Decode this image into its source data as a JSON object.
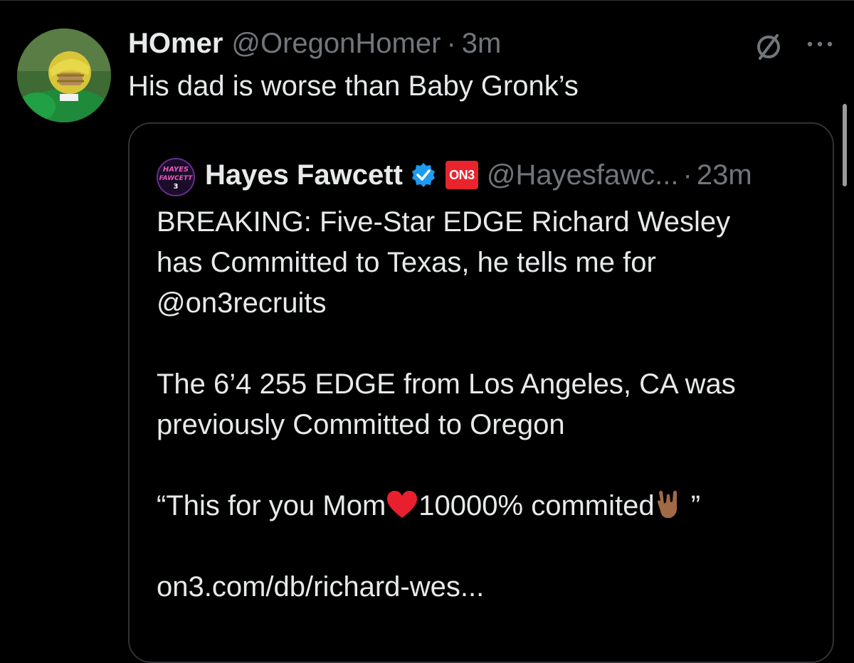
{
  "tweet": {
    "display_name": "HOmer",
    "handle": "@OregonHomer",
    "separator": "·",
    "time": "3m",
    "text": "His dad is worse than Baby Gronk’s",
    "avatar_icon": "football-player-avatar",
    "menu_icon": "more-icon",
    "grok_icon": "slash-icon"
  },
  "quote": {
    "display_name": "Hayes Fawcett",
    "verified_icon": "verified-badge-icon",
    "affiliate_label": "ON3",
    "handle": "@Hayesfawc...",
    "separator": "·",
    "time": "23m",
    "avatar_text": "HAYES FAWCETT 3",
    "paragraphs": [
      [
        "BREAKING: Five-Star EDGE Richard Wesley",
        "has Committed to Texas, he tells me for",
        "@on3recruits"
      ],
      [
        "The 6’4 255 EDGE from Los Angeles, CA was",
        "previously Committed to Oregon"
      ],
      [
        "“This for you Mom",
        "10000% commited",
        " ”"
      ],
      [
        "on3.com/db/richard-wes..."
      ]
    ]
  },
  "colors": {
    "background": "#000000",
    "text": "#e7e9ea",
    "muted": "#71767b",
    "border": "#2f3336",
    "verified": "#1d9bf0",
    "on3_red": "#e8242d"
  }
}
